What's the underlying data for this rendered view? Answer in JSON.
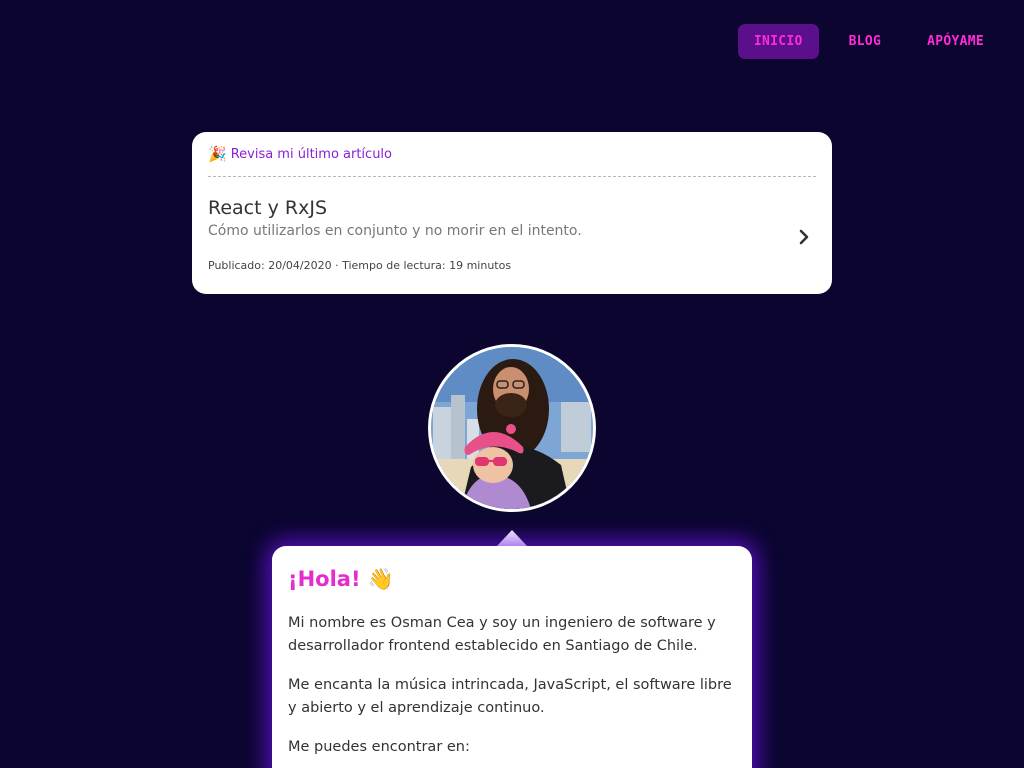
{
  "nav": {
    "items": [
      {
        "label": "INICIO",
        "active": true
      },
      {
        "label": "BLOG",
        "active": false
      },
      {
        "label": "APÓYAME",
        "active": false
      }
    ]
  },
  "latest_article": {
    "header_icon": "party-popper-icon",
    "header_label": "Revisa mi último artículo",
    "title": "React y RxJS",
    "subtitle": "Cómo utilizarlos en conjunto y no morir en el intento.",
    "meta": "Publicado: 20/04/2020 · Tiempo de lectura: 19 minutos"
  },
  "intro": {
    "greeting": "¡Hola!",
    "greeting_icon": "waving-hand-icon",
    "paragraphs": [
      "Mi nombre es Osman Cea y soy un ingeniero de software y desarrollador frontend establecido en Santiago de Chile.",
      "Me encanta la música intrincada, JavaScript, el software libre y abierto y el aprendizaje continuo.",
      "Me puedes encontrar en:"
    ]
  },
  "colors": {
    "background": "#0b0530",
    "accent": "#ff2bd6",
    "nav_active_bg": "#5c0f8a",
    "link_purple": "#8a1fd6",
    "glow": "#6e14e6"
  }
}
